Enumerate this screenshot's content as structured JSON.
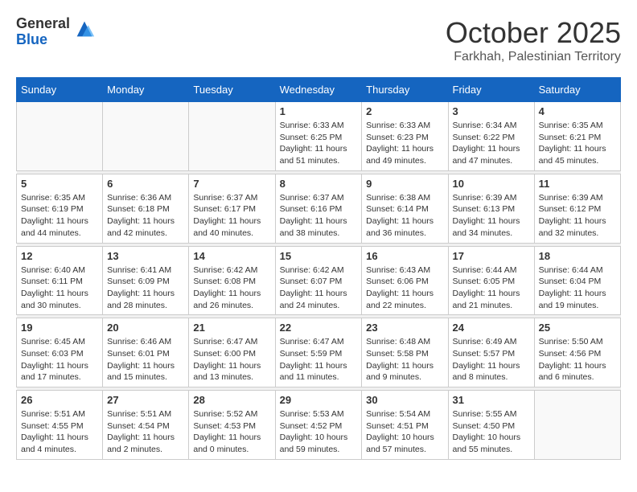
{
  "logo": {
    "general": "General",
    "blue": "Blue"
  },
  "title": "October 2025",
  "subtitle": "Farkhah, Palestinian Territory",
  "days_of_week": [
    "Sunday",
    "Monday",
    "Tuesday",
    "Wednesday",
    "Thursday",
    "Friday",
    "Saturday"
  ],
  "weeks": [
    [
      {
        "day": "",
        "info": ""
      },
      {
        "day": "",
        "info": ""
      },
      {
        "day": "",
        "info": ""
      },
      {
        "day": "1",
        "info": "Sunrise: 6:33 AM\nSunset: 6:25 PM\nDaylight: 11 hours\nand 51 minutes."
      },
      {
        "day": "2",
        "info": "Sunrise: 6:33 AM\nSunset: 6:23 PM\nDaylight: 11 hours\nand 49 minutes."
      },
      {
        "day": "3",
        "info": "Sunrise: 6:34 AM\nSunset: 6:22 PM\nDaylight: 11 hours\nand 47 minutes."
      },
      {
        "day": "4",
        "info": "Sunrise: 6:35 AM\nSunset: 6:21 PM\nDaylight: 11 hours\nand 45 minutes."
      }
    ],
    [
      {
        "day": "5",
        "info": "Sunrise: 6:35 AM\nSunset: 6:19 PM\nDaylight: 11 hours\nand 44 minutes."
      },
      {
        "day": "6",
        "info": "Sunrise: 6:36 AM\nSunset: 6:18 PM\nDaylight: 11 hours\nand 42 minutes."
      },
      {
        "day": "7",
        "info": "Sunrise: 6:37 AM\nSunset: 6:17 PM\nDaylight: 11 hours\nand 40 minutes."
      },
      {
        "day": "8",
        "info": "Sunrise: 6:37 AM\nSunset: 6:16 PM\nDaylight: 11 hours\nand 38 minutes."
      },
      {
        "day": "9",
        "info": "Sunrise: 6:38 AM\nSunset: 6:14 PM\nDaylight: 11 hours\nand 36 minutes."
      },
      {
        "day": "10",
        "info": "Sunrise: 6:39 AM\nSunset: 6:13 PM\nDaylight: 11 hours\nand 34 minutes."
      },
      {
        "day": "11",
        "info": "Sunrise: 6:39 AM\nSunset: 6:12 PM\nDaylight: 11 hours\nand 32 minutes."
      }
    ],
    [
      {
        "day": "12",
        "info": "Sunrise: 6:40 AM\nSunset: 6:11 PM\nDaylight: 11 hours\nand 30 minutes."
      },
      {
        "day": "13",
        "info": "Sunrise: 6:41 AM\nSunset: 6:09 PM\nDaylight: 11 hours\nand 28 minutes."
      },
      {
        "day": "14",
        "info": "Sunrise: 6:42 AM\nSunset: 6:08 PM\nDaylight: 11 hours\nand 26 minutes."
      },
      {
        "day": "15",
        "info": "Sunrise: 6:42 AM\nSunset: 6:07 PM\nDaylight: 11 hours\nand 24 minutes."
      },
      {
        "day": "16",
        "info": "Sunrise: 6:43 AM\nSunset: 6:06 PM\nDaylight: 11 hours\nand 22 minutes."
      },
      {
        "day": "17",
        "info": "Sunrise: 6:44 AM\nSunset: 6:05 PM\nDaylight: 11 hours\nand 21 minutes."
      },
      {
        "day": "18",
        "info": "Sunrise: 6:44 AM\nSunset: 6:04 PM\nDaylight: 11 hours\nand 19 minutes."
      }
    ],
    [
      {
        "day": "19",
        "info": "Sunrise: 6:45 AM\nSunset: 6:03 PM\nDaylight: 11 hours\nand 17 minutes."
      },
      {
        "day": "20",
        "info": "Sunrise: 6:46 AM\nSunset: 6:01 PM\nDaylight: 11 hours\nand 15 minutes."
      },
      {
        "day": "21",
        "info": "Sunrise: 6:47 AM\nSunset: 6:00 PM\nDaylight: 11 hours\nand 13 minutes."
      },
      {
        "day": "22",
        "info": "Sunrise: 6:47 AM\nSunset: 5:59 PM\nDaylight: 11 hours\nand 11 minutes."
      },
      {
        "day": "23",
        "info": "Sunrise: 6:48 AM\nSunset: 5:58 PM\nDaylight: 11 hours\nand 9 minutes."
      },
      {
        "day": "24",
        "info": "Sunrise: 6:49 AM\nSunset: 5:57 PM\nDaylight: 11 hours\nand 8 minutes."
      },
      {
        "day": "25",
        "info": "Sunrise: 5:50 AM\nSunset: 4:56 PM\nDaylight: 11 hours\nand 6 minutes."
      }
    ],
    [
      {
        "day": "26",
        "info": "Sunrise: 5:51 AM\nSunset: 4:55 PM\nDaylight: 11 hours\nand 4 minutes."
      },
      {
        "day": "27",
        "info": "Sunrise: 5:51 AM\nSunset: 4:54 PM\nDaylight: 11 hours\nand 2 minutes."
      },
      {
        "day": "28",
        "info": "Sunrise: 5:52 AM\nSunset: 4:53 PM\nDaylight: 11 hours\nand 0 minutes."
      },
      {
        "day": "29",
        "info": "Sunrise: 5:53 AM\nSunset: 4:52 PM\nDaylight: 10 hours\nand 59 minutes."
      },
      {
        "day": "30",
        "info": "Sunrise: 5:54 AM\nSunset: 4:51 PM\nDaylight: 10 hours\nand 57 minutes."
      },
      {
        "day": "31",
        "info": "Sunrise: 5:55 AM\nSunset: 4:50 PM\nDaylight: 10 hours\nand 55 minutes."
      },
      {
        "day": "",
        "info": ""
      }
    ]
  ]
}
